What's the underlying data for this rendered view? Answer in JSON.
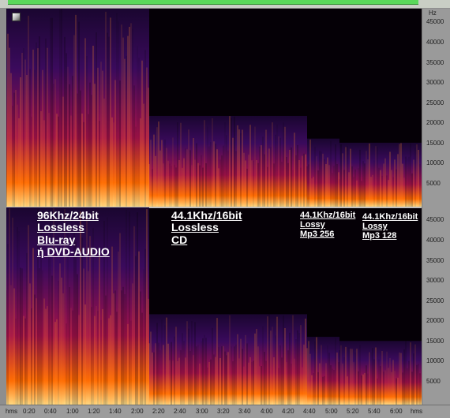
{
  "frequency_axis": {
    "unit": "Hz",
    "labels_top": [
      "45000",
      "40000",
      "35000",
      "30000",
      "25000",
      "20000",
      "15000",
      "10000",
      "5000"
    ],
    "labels_bottom": [
      "45000",
      "40000",
      "35000",
      "30000",
      "25000",
      "20000",
      "15000",
      "10000",
      "5000"
    ]
  },
  "time_axis": {
    "unit_left": "hms",
    "unit_right": "hms",
    "labels": [
      "0:20",
      "0:40",
      "1:00",
      "1:20",
      "1:40",
      "2:00",
      "2:20",
      "2:40",
      "3:00",
      "3:20",
      "3:40",
      "4:00",
      "4:20",
      "4:40",
      "5:00",
      "5:20",
      "5:40",
      "6:00"
    ]
  },
  "segments": [
    {
      "id": "hires",
      "cutoff_hz": 48000,
      "lines": [
        "96Khz/24bit",
        "Lossless",
        "Blu-ray",
        "ή DVD-AUDIO"
      ]
    },
    {
      "id": "cd",
      "cutoff_hz": 22000,
      "lines": [
        "44.1Khz/16bit",
        "Lossless",
        "CD"
      ]
    },
    {
      "id": "mp3-256",
      "cutoff_hz": 16500,
      "lines": [
        "44.1Khz/16bit",
        "Lossy",
        "Mp3 256"
      ]
    },
    {
      "id": "mp3-128",
      "cutoff_hz": 15500,
      "lines": [
        "44.1Khz/16bit",
        "Lossy",
        "Mp3 128"
      ]
    }
  ],
  "colors": {
    "background": "#050006",
    "low": "#3a0a5c",
    "mid": "#a3124a",
    "high": "#ff6a00",
    "peak": "#ffe08a",
    "axis_panel": "#9a9a9a",
    "titlebar_accent": "#5ad85a"
  }
}
